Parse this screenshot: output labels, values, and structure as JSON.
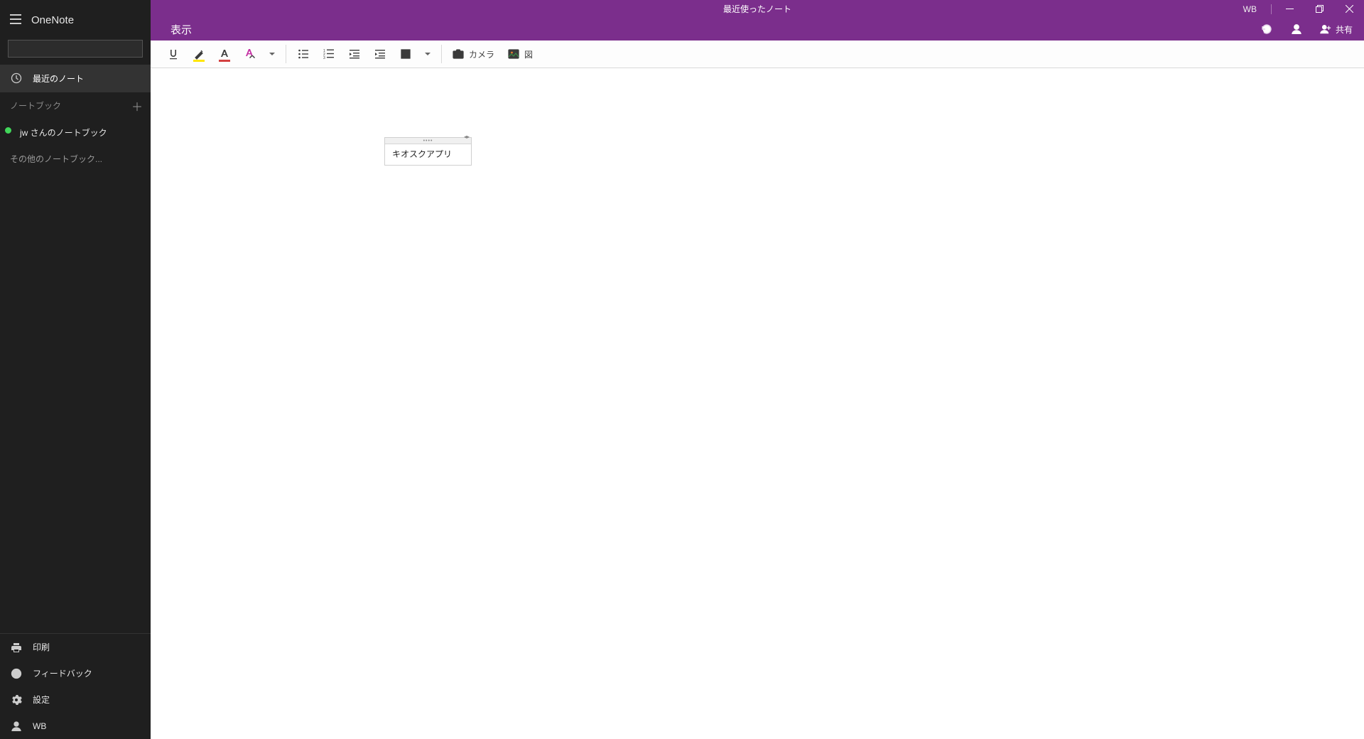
{
  "titlebar": {
    "windowTitle": "最近使ったノート",
    "userInitials": "WB"
  },
  "sidebar": {
    "appTitle": "OneNote",
    "recentNotes": "最近のノート",
    "notebooksLabel": "ノートブック",
    "notebookName": "jw さんのノートブック",
    "otherNotebooks": "その他のノートブック...",
    "print": "印刷",
    "feedback": "フィードバック",
    "settings": "設定",
    "account": "WB"
  },
  "tabs": {
    "view": "表示",
    "share": "共有"
  },
  "toolbar": {
    "camera": "カメラ",
    "picture": "図"
  },
  "note": {
    "text": "キオスクアプリ"
  },
  "colors": {
    "purple": "#7b2e8c",
    "highlightYellow": "#ffe600",
    "fontColorRed": "#d44141",
    "styleMagenta": "#c430a3"
  }
}
